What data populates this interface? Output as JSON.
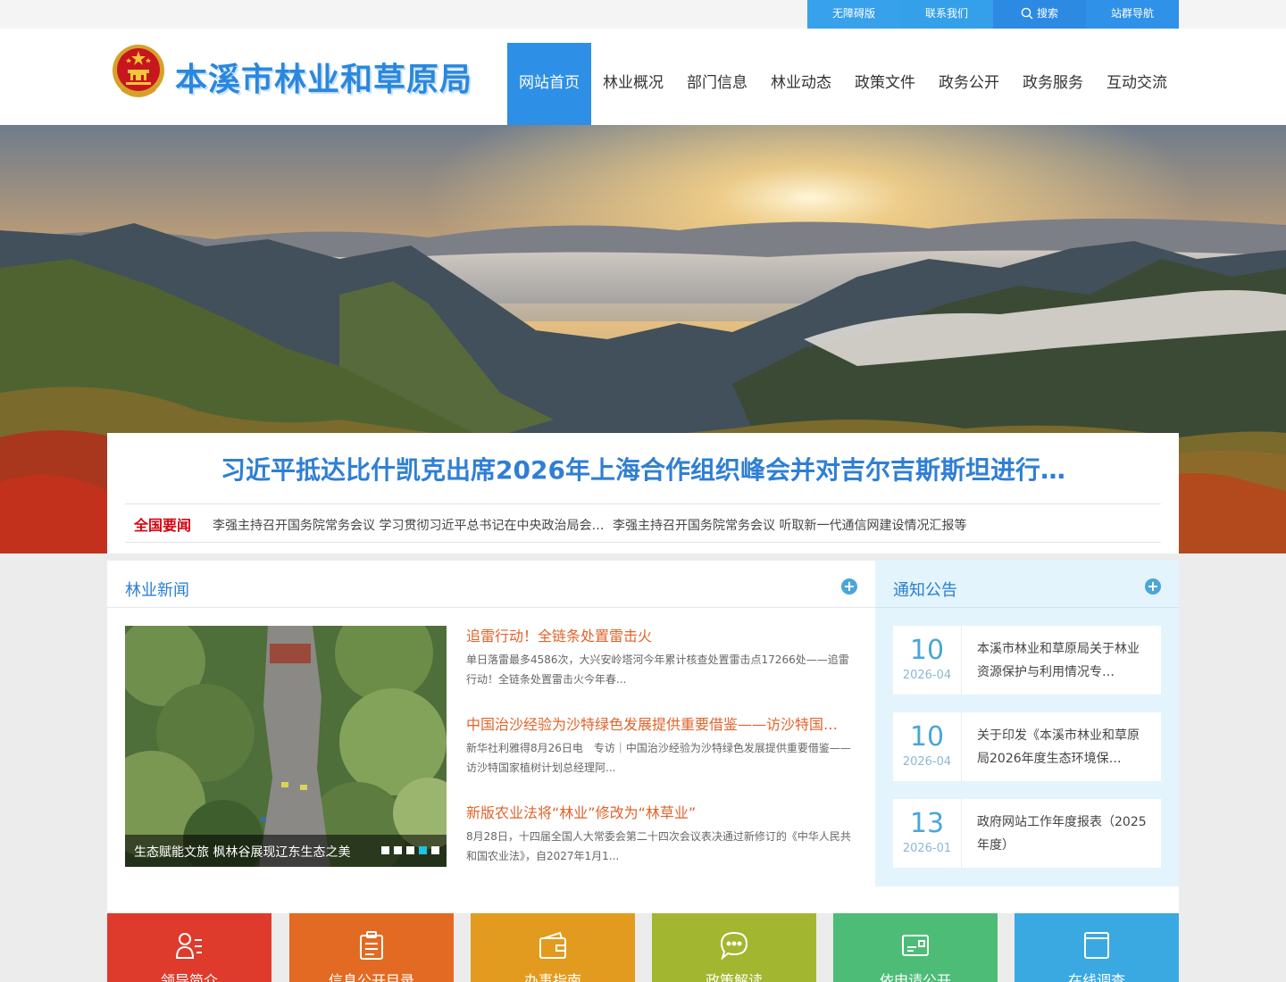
{
  "topbar": {
    "accessible": "无障碍版",
    "contact": "联系我们",
    "search": "搜索",
    "sitenav": "站群导航"
  },
  "header": {
    "site_title": "本溪市林业和草原局",
    "nav": [
      "网站首页",
      "林业概况",
      "部门信息",
      "林业动态",
      "政策文件",
      "政务公开",
      "政务服务",
      "互动交流"
    ],
    "active_nav": "网站首页"
  },
  "headline": {
    "title": "习近平抵达比什凯克出席2026年上海合作组织峰会并对吉尔吉斯斯坦进行…",
    "strip_label": "全国要闻",
    "items": [
      "李强主持召开国务院常务会议 学习贯彻习近平总书记在中央政治局会…",
      "李强主持召开国务院常务会议 听取新一代通信网建设情况汇报等"
    ]
  },
  "forestry_news": {
    "title": "林业新闻",
    "slider_caption": "生态赋能文旅 枫林谷展现辽东生态之美",
    "active_dot": 4,
    "items": [
      {
        "title": "追雷行动！全链条处置雷击火",
        "summary": "单日落雷最多4586次，大兴安岭塔河今年累计核查处置雷击点17266处——追雷行动！全链条处置雷击火今年春..."
      },
      {
        "title": "中国治沙经验为沙特绿色发展提供重要借鉴——访沙特国…",
        "summary": "新华社利雅得8月26日电　专访｜中国治沙经验为沙特绿色发展提供重要借鉴——访沙特国家植树计划总经理阿..."
      },
      {
        "title": "新版农业法将“林业”修改为“林草业”",
        "summary": "8月28日，十四届全国人大常委会第二十四次会议表决通过新修订的《中华人民共和国农业法》，自2027年1月1..."
      }
    ]
  },
  "notices": {
    "title": "通知公告",
    "items": [
      {
        "day": "10",
        "ym": "2026-04",
        "text": "本溪市林业和草原局关于林业资源保护与利用情况专…"
      },
      {
        "day": "10",
        "ym": "2026-04",
        "text": "关于印发《本溪市林业和草原局2026年度生态环境保…"
      },
      {
        "day": "13",
        "ym": "2026-01",
        "text": "政府网站工作年度报表（2025年度）"
      }
    ]
  },
  "tiles": [
    {
      "label": "领导简介",
      "icon": "user-list-icon",
      "color": "#de3b2c"
    },
    {
      "label": "信息公开目录",
      "icon": "clipboard-icon",
      "color": "#e36a22"
    },
    {
      "label": "办事指南",
      "icon": "wallet-icon",
      "color": "#e29b1e"
    },
    {
      "label": "政策解读",
      "icon": "chat-bubble-icon",
      "color": "#a3b62f"
    },
    {
      "label": "依申请公开",
      "icon": "id-card-icon",
      "color": "#4cbc77"
    },
    {
      "label": "在线调查",
      "icon": "checklist-icon",
      "color": "#3aa9e2"
    }
  ]
}
